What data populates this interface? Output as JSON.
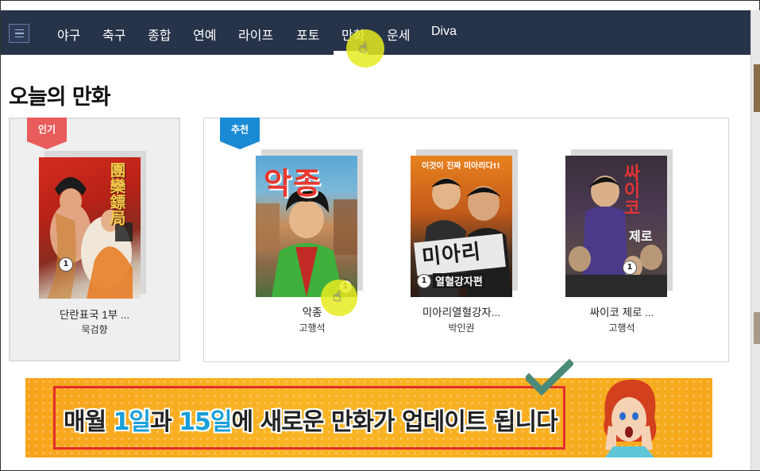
{
  "nav": {
    "items": [
      "야구",
      "축구",
      "종합",
      "연예",
      "라이프",
      "포토",
      "만화",
      "운세",
      "Diva"
    ],
    "active": "만화"
  },
  "page": {
    "title": "오늘의 만화"
  },
  "popular": {
    "ribbon": "인기",
    "book": {
      "title": "단란표국 1부 ...",
      "author": "묵검향",
      "cover_text": "團欒鏢局",
      "volume": "1"
    }
  },
  "recommended": {
    "ribbon": "추천",
    "books": [
      {
        "title": "악종",
        "author": "고행석",
        "cover_text": "악종",
        "volume": "1"
      },
      {
        "title": "미아리열혈강자...",
        "author": "박인권",
        "cover_text": "미아리",
        "cover_top": "이것이 진짜 미아리다!!",
        "cover_sub": "열혈강자편",
        "volume": "1"
      },
      {
        "title": "싸이코 제로 ...",
        "author": "고행석",
        "cover_text": "싸이코",
        "cover_sub": "제로",
        "volume": "1"
      }
    ]
  },
  "banner": {
    "text_pre": "매월 ",
    "hl1": "1일",
    "text_mid": "과 ",
    "hl2": "15일",
    "text_post": "에 새로운 만화가 업데이트 됩니다"
  },
  "colors": {
    "nav_bg": "#273349",
    "popular_ribbon": "#e85c5c",
    "recommended_ribbon": "#1b8ad4",
    "banner_bg": "#f7a41c",
    "banner_frame": "#e32d2d",
    "highlight_text": "#1a9fd8",
    "checkmark": "#4a8a78"
  },
  "icons": {
    "menu": "hamburger-menu-icon",
    "cursor": "hand-pointer-icon",
    "check": "checkmark-icon"
  }
}
